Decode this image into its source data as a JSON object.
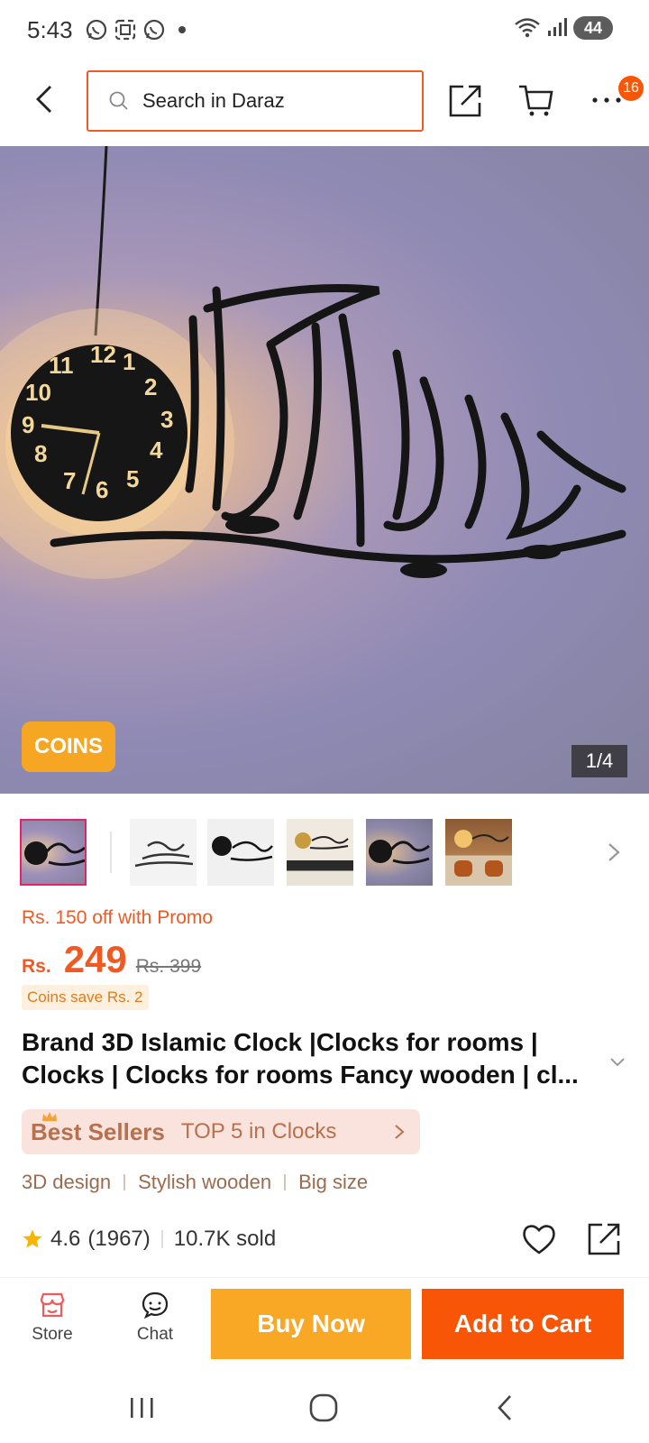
{
  "status_bar": {
    "time": "5:43",
    "battery": "44",
    "icons": [
      "whatsapp-icon",
      "screenshot-icon",
      "whatsapp-icon",
      "wifi-icon",
      "signal-icon",
      "battery-icon"
    ]
  },
  "top_nav": {
    "search_placeholder": "Search in Daraz",
    "cart_badge": "16"
  },
  "hero": {
    "coins_badge": "COINS",
    "counter": "1/4"
  },
  "thumbnails": {
    "count": 6,
    "selected_index": 0
  },
  "price": {
    "promo": "Rs. 150 off with Promo",
    "currency": "Rs.",
    "current": "249",
    "original": "Rs. 399",
    "coins_save": "Coins save Rs. 2"
  },
  "product": {
    "title_line1": "Brand 3D Islamic Clock |Clocks for rooms |",
    "title_line2": "Clocks | Clocks for rooms Fancy wooden | cl..."
  },
  "bestsellers": {
    "label": "Best Sellers",
    "text": "TOP 5 in Clocks"
  },
  "tags": [
    "3D design",
    "Stylish wooden",
    "Big size"
  ],
  "rating": {
    "score": "4.6",
    "count": "(1967)",
    "sold": "10.7K sold"
  },
  "bottom_bar": {
    "store_label": "Store",
    "chat_label": "Chat",
    "buy_now": "Buy Now",
    "add_to_cart": "Add to Cart"
  },
  "colors": {
    "accent": "#f85606",
    "buy_now": "#f9a825",
    "promo_text": "#f05a22",
    "bestseller_bg": "#f9e3dc",
    "bestseller_text": "#b8714e"
  }
}
